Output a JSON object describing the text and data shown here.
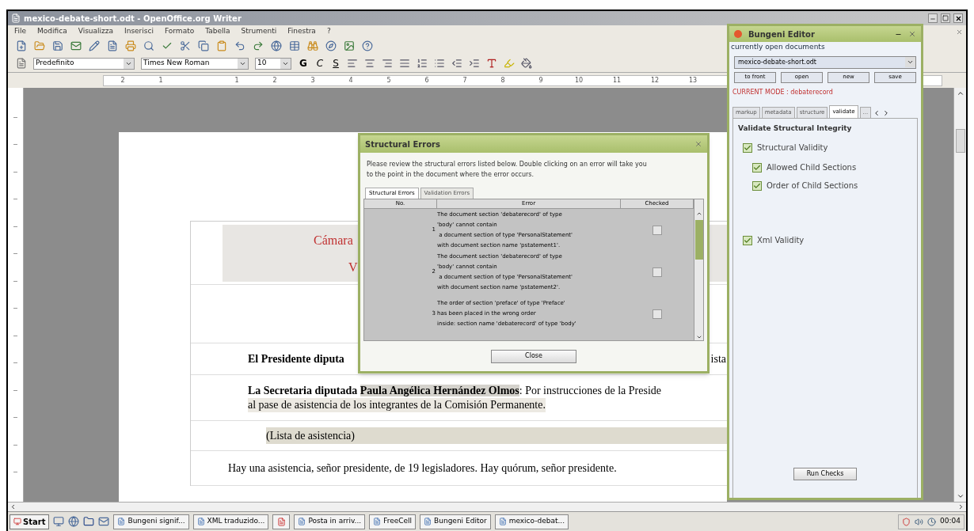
{
  "window": {
    "title": "mexico-debate-short.odt - OpenOffice.org Writer"
  },
  "menu": [
    "File",
    "Modifica",
    "Visualizza",
    "Inserisci",
    "Formato",
    "Tabella",
    "Strumenti",
    "Finestra",
    "?"
  ],
  "format_bar": {
    "style": "Predefinito",
    "font": "Times New Roman",
    "size": "10",
    "bold": "G",
    "italic": "C",
    "underline": "S"
  },
  "ruler": [
    "2",
    "1",
    "1",
    "2",
    "3",
    "4",
    "5",
    "6",
    "7",
    "8",
    "9",
    "10",
    "11",
    "12",
    "13"
  ],
  "document": {
    "header": [
      "Cámara",
      "V"
    ],
    "paragraphs": [
      {
        "kind": "split",
        "left": "El Presidente diputa",
        "right": "ista"
      },
      {
        "kind": "speech",
        "segments": [
          {
            "text": "La Secretaria diputada ",
            "bold": true,
            "highlight": false
          },
          {
            "text": "Paula Angélica Hernández Olmos",
            "bold": true,
            "highlight": true
          },
          {
            "text": ": Por instrucciones de la Preside",
            "bold": false,
            "highlight": false
          }
        ],
        "continuation": "al pase de asistencia de los integrantes de la Comisión Permanente."
      },
      {
        "kind": "note",
        "text": "(Lista de asistencia)"
      },
      {
        "kind": "plain",
        "text": "Hay una asistencia, señor presidente, de 19 legisladores. Hay quórum, señor presidente."
      }
    ]
  },
  "errors_dialog": {
    "title": "Structural Errors",
    "description": "Please review the structural errors listed below. Double clicking on an error will take you to the point in the document where the error occurs.",
    "tabs": [
      {
        "label": "Structural Errors",
        "selected": true
      },
      {
        "label": "Validation Errors",
        "selected": false
      }
    ],
    "columns": [
      "No.",
      "Error",
      "Checked"
    ],
    "rows": [
      {
        "no": "1",
        "lines": [
          "The document section 'debaterecord' of type",
          "'body' cannot contain",
          " a document section of type 'PersonalStatement'",
          "with document section name 'pstatement1'."
        ],
        "checked": false
      },
      {
        "no": "2",
        "lines": [
          "The document section 'debaterecord' of type",
          "'body' cannot contain",
          " a document section of type 'PersonalStatement'",
          "with document section name 'pstatement2'."
        ],
        "checked": false
      },
      {
        "no": "3",
        "lines": [
          "The order of section 'preface' of type 'Preface'",
          "has been placed in the wrong order",
          "inside: section name 'debaterecord' of type 'body'"
        ],
        "checked": false
      }
    ],
    "button": "Close"
  },
  "bungeni": {
    "title": "Bungeni Editor",
    "open_label": "currently open documents",
    "document": "mexico-debate-short.odt",
    "buttons": [
      "to front",
      "open",
      "new",
      "save"
    ],
    "mode": "CURRENT MODE : debaterecord",
    "tabs": [
      {
        "label": "markup",
        "selected": false
      },
      {
        "label": "metadata",
        "selected": false
      },
      {
        "label": "structure",
        "selected": false
      },
      {
        "label": "validate",
        "selected": true
      },
      {
        "label": "...",
        "selected": false
      }
    ],
    "heading": "Validate Structural Integrity",
    "checks": [
      {
        "label": "Structural Validity",
        "checked": true,
        "children": [
          {
            "label": "Allowed Child Sections",
            "checked": true
          },
          {
            "label": "Order of Child Sections",
            "checked": true
          }
        ]
      },
      {
        "label": "Xml Validity",
        "checked": true
      }
    ],
    "run_button": "Run Checks"
  },
  "taskbar": {
    "start": "Start",
    "tasks": [
      "Bungeni signif...",
      "XML traduzido...",
      "Posta in arriv...",
      "FreeCell",
      "Bungeni Editor",
      "mexico-debat..."
    ],
    "clock": "00:04"
  }
}
